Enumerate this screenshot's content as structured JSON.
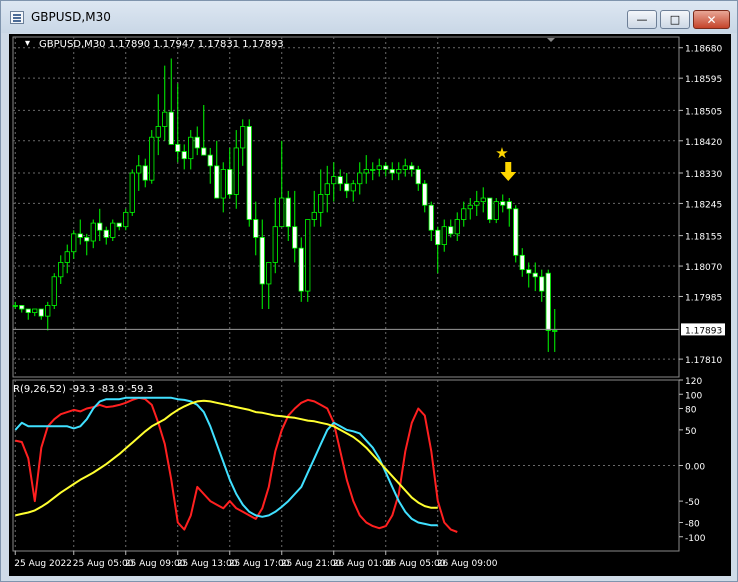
{
  "window": {
    "title": "GBPUSD,M30",
    "minimize_label": "—",
    "maximize_label": "□",
    "close_label": "✕"
  },
  "chart_data": [
    {
      "type": "candlestick",
      "header": "GBPUSD,M30  1.17890 1.17947 1.17831 1.17893",
      "ylim": [
        1.1776,
        1.1871
      ],
      "y_ticks": [
        "1.18680",
        "1.18595",
        "1.18505",
        "1.18420",
        "1.18330",
        "1.18245",
        "1.18155",
        "1.18070",
        "1.17985",
        "1.17893",
        "1.17810"
      ],
      "y_tick_values": [
        1.1868,
        1.18595,
        1.18505,
        1.1842,
        1.1833,
        1.18245,
        1.18155,
        1.1807,
        1.17985,
        1.17893,
        1.1781
      ],
      "current_price": 1.17893,
      "current_price_label": "1.17893",
      "colors": {
        "bull": "#ffffff",
        "bear": "#ffffff",
        "wick": "#00ff00",
        "grid": "#6a6a6a",
        "price_line": "#9a9a9a"
      },
      "arrow_color": "#ffd700",
      "signal_icons": [
        "star-icon",
        "arrow-down-icon"
      ],
      "signal_index": 76,
      "candles": [
        [
          1.1796,
          1.1797,
          1.1795,
          1.1796
        ],
        [
          1.1796,
          1.1796,
          1.1794,
          1.1795
        ],
        [
          1.1795,
          1.1795,
          1.1792,
          1.1794
        ],
        [
          1.1794,
          1.1795,
          1.1793,
          1.1795
        ],
        [
          1.1795,
          1.1795,
          1.1792,
          1.1793
        ],
        [
          1.1793,
          1.1797,
          1.1789,
          1.1796
        ],
        [
          1.1796,
          1.1805,
          1.1795,
          1.1804
        ],
        [
          1.1804,
          1.181,
          1.1802,
          1.1808
        ],
        [
          1.1808,
          1.1813,
          1.1805,
          1.1811
        ],
        [
          1.1811,
          1.1817,
          1.1809,
          1.1816
        ],
        [
          1.1816,
          1.182,
          1.1813,
          1.1815
        ],
        [
          1.1815,
          1.1816,
          1.181,
          1.1814
        ],
        [
          1.1814,
          1.182,
          1.1812,
          1.1819
        ],
        [
          1.1819,
          1.1823,
          1.1814,
          1.1817
        ],
        [
          1.1817,
          1.1818,
          1.1813,
          1.1815
        ],
        [
          1.1815,
          1.182,
          1.1814,
          1.1819
        ],
        [
          1.1819,
          1.1818,
          1.1817,
          1.1818
        ],
        [
          1.1818,
          1.1823,
          1.1817,
          1.1822
        ],
        [
          1.1822,
          1.1834,
          1.1821,
          1.1833
        ],
        [
          1.1833,
          1.1838,
          1.1828,
          1.1835
        ],
        [
          1.1835,
          1.1837,
          1.1829,
          1.1831
        ],
        [
          1.1831,
          1.1845,
          1.183,
          1.1843
        ],
        [
          1.1843,
          1.1855,
          1.1838,
          1.1846
        ],
        [
          1.1846,
          1.1863,
          1.1842,
          1.185
        ],
        [
          1.185,
          1.1865,
          1.1845,
          1.1841
        ],
        [
          1.1841,
          1.1858,
          1.1836,
          1.1839
        ],
        [
          1.1839,
          1.1841,
          1.1834,
          1.1837
        ],
        [
          1.1837,
          1.1845,
          1.1834,
          1.1843
        ],
        [
          1.1843,
          1.1846,
          1.1838,
          1.184
        ],
        [
          1.184,
          1.1852,
          1.1838,
          1.1838
        ],
        [
          1.1838,
          1.184,
          1.183,
          1.1835
        ],
        [
          1.1835,
          1.1842,
          1.1826,
          1.1826
        ],
        [
          1.1826,
          1.1836,
          1.1822,
          1.1834
        ],
        [
          1.1834,
          1.184,
          1.1826,
          1.1827
        ],
        [
          1.1827,
          1.1845,
          1.1823,
          1.184
        ],
        [
          1.184,
          1.1848,
          1.1835,
          1.1846
        ],
        [
          1.1846,
          1.1848,
          1.1818,
          1.182
        ],
        [
          1.182,
          1.1825,
          1.181,
          1.1815
        ],
        [
          1.1815,
          1.182,
          1.1795,
          1.1802
        ],
        [
          1.1802,
          1.1808,
          1.1795,
          1.1808
        ],
        [
          1.1808,
          1.1826,
          1.1805,
          1.1818
        ],
        [
          1.1818,
          1.1842,
          1.1818,
          1.1826
        ],
        [
          1.1826,
          1.1828,
          1.1814,
          1.1818
        ],
        [
          1.1818,
          1.1828,
          1.1808,
          1.1812
        ],
        [
          1.1812,
          1.1815,
          1.1797,
          1.18
        ],
        [
          1.18,
          1.182,
          1.1797,
          1.182
        ],
        [
          1.182,
          1.1828,
          1.1818,
          1.1822
        ],
        [
          1.1822,
          1.1834,
          1.1818,
          1.1827
        ],
        [
          1.1827,
          1.1835,
          1.1822,
          1.183
        ],
        [
          1.183,
          1.1836,
          1.1825,
          1.1832
        ],
        [
          1.1832,
          1.1834,
          1.1828,
          1.183
        ],
        [
          1.183,
          1.1833,
          1.1826,
          1.1828
        ],
        [
          1.1828,
          1.1831,
          1.1825,
          1.183
        ],
        [
          1.183,
          1.1836,
          1.1827,
          1.1833
        ],
        [
          1.1833,
          1.1838,
          1.183,
          1.1834
        ],
        [
          1.1834,
          1.1836,
          1.1831,
          1.1834
        ],
        [
          1.1834,
          1.1837,
          1.1832,
          1.1835
        ],
        [
          1.1835,
          1.1836,
          1.1832,
          1.1834
        ],
        [
          1.1834,
          1.1836,
          1.1831,
          1.1833
        ],
        [
          1.1833,
          1.1836,
          1.1831,
          1.1834
        ],
        [
          1.1834,
          1.1837,
          1.1832,
          1.1835
        ],
        [
          1.1835,
          1.1836,
          1.1832,
          1.1834
        ],
        [
          1.1834,
          1.1835,
          1.1828,
          1.183
        ],
        [
          1.183,
          1.1831,
          1.1822,
          1.1824
        ],
        [
          1.1824,
          1.1825,
          1.1814,
          1.1817
        ],
        [
          1.1817,
          1.1818,
          1.1805,
          1.1813
        ],
        [
          1.1813,
          1.182,
          1.1811,
          1.1818
        ],
        [
          1.1818,
          1.182,
          1.1815,
          1.1816
        ],
        [
          1.1816,
          1.1822,
          1.1814,
          1.182
        ],
        [
          1.182,
          1.1825,
          1.1818,
          1.1823
        ],
        [
          1.1823,
          1.1826,
          1.182,
          1.1824
        ],
        [
          1.1824,
          1.1828,
          1.1821,
          1.1825
        ],
        [
          1.1825,
          1.1829,
          1.1822,
          1.1826
        ],
        [
          1.1826,
          1.1826,
          1.1819,
          1.182
        ],
        [
          1.182,
          1.1826,
          1.1819,
          1.1825
        ],
        [
          1.1825,
          1.1827,
          1.1822,
          1.1824
        ],
        [
          1.1825,
          1.1826,
          1.1818,
          1.1823
        ],
        [
          1.1823,
          1.1824,
          1.1808,
          1.181
        ],
        [
          1.181,
          1.1812,
          1.1804,
          1.1806
        ],
        [
          1.1806,
          1.1808,
          1.1801,
          1.1805
        ],
        [
          1.1805,
          1.1808,
          1.18,
          1.1804
        ],
        [
          1.1804,
          1.1806,
          1.1797,
          1.18
        ],
        [
          1.1805,
          1.1806,
          1.1783,
          1.1789
        ],
        [
          1.1789,
          1.1795,
          1.1783,
          1.1789
        ]
      ]
    },
    {
      "type": "line",
      "label": "R(9,26,52) -93.3 -83.9 -59.3",
      "ylim": [
        -120,
        120
      ],
      "y_ticks": [
        "120",
        "100",
        "80",
        "50",
        "0.00",
        "-50",
        "-80",
        "-100"
      ],
      "y_tick_values": [
        120,
        100,
        80,
        50,
        0,
        -50,
        -80,
        -100
      ],
      "x_ticks": [
        "25 Aug 2022",
        "25 Aug 05:00",
        "25 Aug 09:00",
        "25 Aug 13:00",
        "25 Aug 17:00",
        "25 Aug 21:00",
        "26 Aug 01:00",
        "26 Aug 05:00",
        "26 Aug 09:00"
      ],
      "x_tick_index": [
        0,
        9,
        17,
        25,
        33,
        41,
        49,
        57,
        65
      ],
      "series": [
        {
          "color": "#ff2020",
          "values": [
            35,
            33,
            10,
            -50,
            25,
            55,
            65,
            72,
            75,
            78,
            76,
            80,
            82,
            85,
            82,
            83,
            85,
            88,
            92,
            95,
            93,
            85,
            60,
            30,
            -20,
            -80,
            -90,
            -70,
            -30,
            -40,
            -50,
            -55,
            -60,
            -50,
            -60,
            -65,
            -70,
            -75,
            -60,
            -30,
            20,
            50,
            70,
            80,
            88,
            92,
            90,
            85,
            80,
            60,
            20,
            -20,
            -50,
            -70,
            -80,
            -85,
            -88,
            -85,
            -70,
            -40,
            20,
            60,
            80,
            70,
            20,
            -50,
            -80,
            -90,
            -93.3
          ]
        },
        {
          "color": "#40e0ff",
          "values": [
            50,
            60,
            55,
            55,
            55,
            55,
            55,
            55,
            55,
            52,
            55,
            65,
            80,
            90,
            93,
            93,
            93,
            95,
            95,
            95,
            95,
            95,
            95,
            95,
            95,
            93,
            92,
            90,
            85,
            75,
            55,
            30,
            5,
            -20,
            -40,
            -55,
            -65,
            -70,
            -72,
            -70,
            -65,
            -58,
            -50,
            -40,
            -30,
            -10,
            10,
            30,
            50,
            60,
            55,
            50,
            48,
            45,
            35,
            25,
            10,
            -10,
            -30,
            -50,
            -65,
            -75,
            -80,
            -82,
            -83.9,
            -83.9
          ]
        },
        {
          "color": "#ffff30",
          "values": [
            -70,
            -68,
            -66,
            -63,
            -58,
            -52,
            -45,
            -38,
            -32,
            -26,
            -20,
            -15,
            -10,
            -4,
            2,
            9,
            16,
            24,
            32,
            40,
            48,
            55,
            60,
            65,
            72,
            78,
            83,
            87,
            90,
            91,
            90,
            88,
            86,
            84,
            82,
            80,
            78,
            75,
            74,
            72,
            70,
            69,
            68,
            67,
            65,
            63,
            62,
            60,
            58,
            55,
            50,
            45,
            40,
            33,
            25,
            15,
            5,
            -5,
            -15,
            -25,
            -35,
            -45,
            -52,
            -57,
            -59.3,
            -59.3
          ]
        }
      ]
    }
  ]
}
